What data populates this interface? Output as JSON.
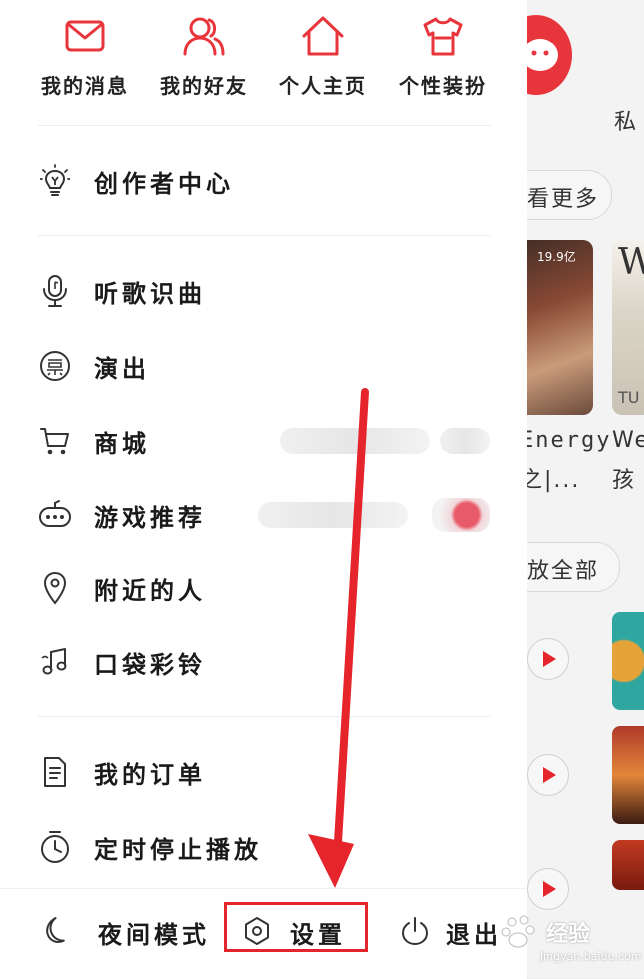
{
  "top_shortcuts": [
    {
      "label": "我的消息",
      "icon": "mail-icon"
    },
    {
      "label": "我的好友",
      "icon": "friends-icon"
    },
    {
      "label": "个人主页",
      "icon": "home-icon"
    },
    {
      "label": "个性装扮",
      "icon": "tshirt-icon"
    }
  ],
  "creator": {
    "label": "创作者中心",
    "icon": "lightbulb-icon"
  },
  "menu_group_1": [
    {
      "label": "听歌识曲",
      "icon": "microphone-icon"
    },
    {
      "label": "演出",
      "icon": "ticket-icon"
    },
    {
      "label": "商城",
      "icon": "cart-icon"
    },
    {
      "label": "游戏推荐",
      "icon": "gamepad-icon"
    },
    {
      "label": "附近的人",
      "icon": "location-pin-icon"
    },
    {
      "label": "口袋彩铃",
      "icon": "music-note-icon"
    }
  ],
  "menu_group_2": [
    {
      "label": "我的订单",
      "icon": "document-icon"
    },
    {
      "label": "定时停止播放",
      "icon": "timer-icon"
    }
  ],
  "bottom_bar": {
    "night_mode": "夜间模式",
    "settings": "设置",
    "logout": "退出"
  },
  "background": {
    "private_label": "私",
    "see_more": "看更多",
    "play_count": "19.9亿",
    "card1_title": "Energy",
    "card1_sub": "之|...",
    "card2_title": "Wes",
    "card2_sub": "孩",
    "play_all": "放全部",
    "card_letter": "W",
    "card_tu": "TU"
  },
  "watermark": {
    "text": "经验",
    "sub": "jingyan.baidu.com"
  },
  "colors": {
    "accent": "#e5242b",
    "icon_red": "#e8343b"
  }
}
